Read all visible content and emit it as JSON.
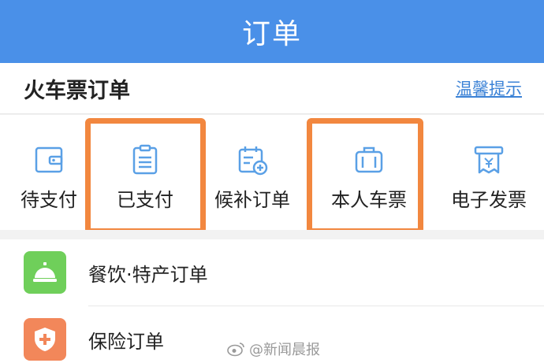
{
  "header": {
    "title": "订单"
  },
  "section": {
    "title": "火车票订单",
    "tips_link": "温馨提示"
  },
  "tiles": [
    {
      "label": "待支付",
      "icon": "wallet-icon"
    },
    {
      "label": "已支付",
      "icon": "clipboard-icon"
    },
    {
      "label": "候补订单",
      "icon": "calendar-add-icon"
    },
    {
      "label": "本人车票",
      "icon": "luggage-icon"
    },
    {
      "label": "电子发票",
      "icon": "receipt-icon"
    }
  ],
  "list": [
    {
      "label": "餐饮·特产订单",
      "icon": "service-bell-icon",
      "color": "#6fcf5a"
    },
    {
      "label": "保险订单",
      "icon": "shield-plus-icon",
      "color": "#f2875a"
    }
  ],
  "watermark": {
    "text": "@新闻晨报"
  },
  "colors": {
    "header": "#4a90e8",
    "highlight": "#f2873f",
    "link": "#3b82d6"
  }
}
